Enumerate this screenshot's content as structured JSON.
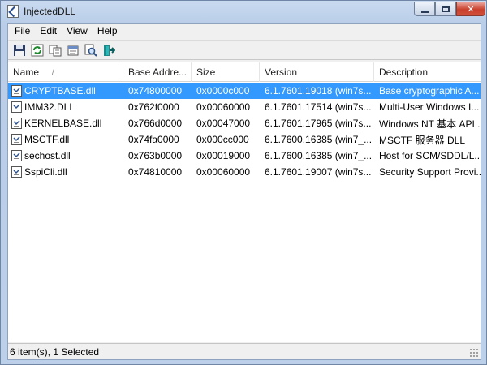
{
  "window": {
    "title": "InjectedDLL",
    "controls": {
      "minimize": "minimize",
      "maximize": "maximize",
      "close": "✕"
    }
  },
  "menu": [
    "File",
    "Edit",
    "View",
    "Help"
  ],
  "toolbar": {
    "buttons": [
      "save-icon",
      "refresh-icon",
      "copy-icon",
      "properties-icon",
      "find-icon",
      "exit-icon"
    ]
  },
  "table": {
    "columns": [
      "Name",
      "Base Addre...",
      "Size",
      "Version",
      "Description"
    ],
    "sort_indicator": "/",
    "rows": [
      {
        "name": "CRYPTBASE.dll",
        "base": "0x74800000",
        "size": "0x0000c000",
        "version": "6.1.7601.19018 (win7s...",
        "description": "Base cryptographic A...",
        "selected": true
      },
      {
        "name": "IMM32.DLL",
        "base": "0x762f0000",
        "size": "0x00060000",
        "version": "6.1.7601.17514 (win7s...",
        "description": "Multi-User Windows I...",
        "selected": false
      },
      {
        "name": "KERNELBASE.dll",
        "base": "0x766d0000",
        "size": "0x00047000",
        "version": "6.1.7601.17965 (win7s...",
        "description": "Windows NT 基本 API ...",
        "selected": false
      },
      {
        "name": "MSCTF.dll",
        "base": "0x74fa0000",
        "size": "0x000cc000",
        "version": "6.1.7600.16385 (win7_...",
        "description": "MSCTF 服务器 DLL",
        "selected": false
      },
      {
        "name": "sechost.dll",
        "base": "0x763b0000",
        "size": "0x00019000",
        "version": "6.1.7600.16385 (win7_...",
        "description": "Host for SCM/SDDL/L...",
        "selected": false
      },
      {
        "name": "SspiCli.dll",
        "base": "0x74810000",
        "size": "0x00060000",
        "version": "6.1.7601.19007 (win7s...",
        "description": "Security Support Provi...",
        "selected": false
      }
    ]
  },
  "status": {
    "text": "6 item(s), 1 Selected"
  },
  "colors": {
    "selection": "#3399ff",
    "titlebar": "#c9daf0"
  }
}
